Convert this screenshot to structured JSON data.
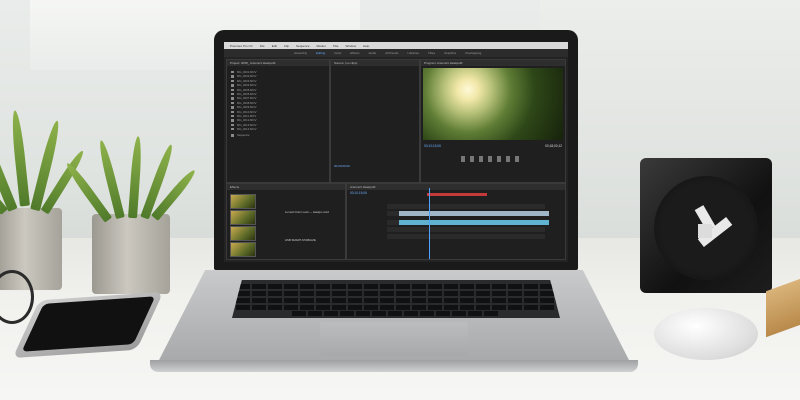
{
  "app": {
    "title": "Premiere Pro CC"
  },
  "menu": [
    "File",
    "Edit",
    "Clip",
    "Sequence",
    "Marker",
    "Title",
    "Window",
    "Help"
  ],
  "workspaces": [
    "Assembly",
    "Editing",
    "Color",
    "Effects",
    "Audio",
    "All Panels",
    "Libraries",
    "Titles",
    "Graphics",
    "Overlapping"
  ],
  "active_workspace": "Editing",
  "project_panel": {
    "tabs": [
      "Project: 0058_ AntonioV.HaskpoM",
      "Media"
    ],
    "files": [
      "MG_0001.MOV",
      "MG_0002.MOV",
      "MG_0003.MOV",
      "MG_0004.MOV",
      "MG_0005.MOV",
      "MG_0006.MOV",
      "MG_0007.MOV",
      "MG_0008.MOV",
      "MG_0009.MOV",
      "MG_0010.MOV",
      "MG_0011.MOV",
      "MG_0012.MOV",
      "MG_0013.MOV",
      "MG_0014.MOV"
    ],
    "sequence": "Sequence"
  },
  "source_panel": {
    "tabs": [
      "Source: (no clips)",
      "Effect Controls",
      "Audio Track Mixer"
    ],
    "timecode": "00;00;00;00"
  },
  "program_panel": {
    "title": "Program: AntonioV.HaskpoM",
    "timecode_left": "00;10;15;06",
    "timecode_right": "00;18;00;12"
  },
  "effects_panel": {
    "tabs": [
      "Effects",
      "Markers"
    ],
    "clip_note": "Lumetri Color Look — Haskpo vivid",
    "clip_label": "HSB SMART-STABILIZE"
  },
  "timeline": {
    "tabs": [
      "Master Sequence",
      "AntonioV.HaskpoM"
    ],
    "timecode": "00;10;15;06"
  },
  "colors": {
    "accent": "#4fa3ff",
    "ui_dark": "#1f1f1f",
    "clip_video": "#9fb6c9",
    "clip_audio": "#5fb3d0",
    "marker": "#c43a3a"
  }
}
